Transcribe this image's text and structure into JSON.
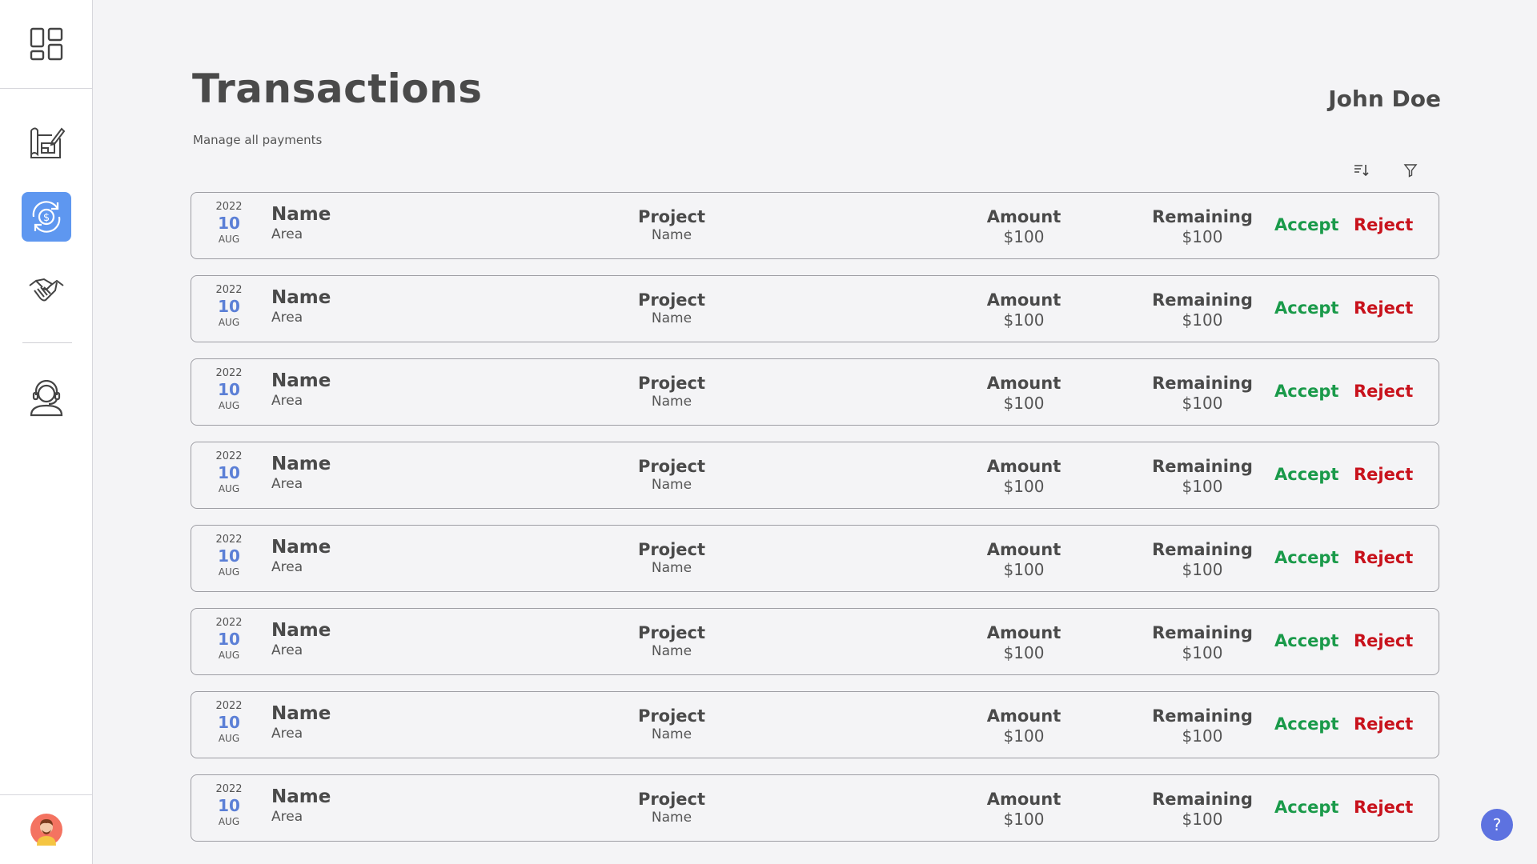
{
  "header": {
    "title": "Transactions",
    "subtitle": "Manage all payments",
    "user_name": "John Doe"
  },
  "sidebar": {
    "items": [
      {
        "icon": "blueprint-icon",
        "active": false
      },
      {
        "icon": "dollar-exchange-icon",
        "active": true
      },
      {
        "icon": "handshake-icon",
        "active": false
      },
      {
        "icon": "support-agent-icon",
        "active": false
      }
    ]
  },
  "toolbar": {
    "sort_icon": "sort-icon",
    "filter_icon": "filter-icon"
  },
  "colors": {
    "accent": "#5e97f0",
    "date_day": "#5b7fd6",
    "accept": "#1a9a4a",
    "reject": "#c8121c",
    "help": "#5d72e0"
  },
  "transactions": [
    {
      "year": "2022",
      "day": "10",
      "month": "AUG",
      "name": "Name",
      "area": "Area",
      "project_label": "Project",
      "project_name": "Name",
      "amount_label": "Amount",
      "amount": "$100",
      "remaining_label": "Remaining",
      "remaining": "$100",
      "accept": "Accept",
      "reject": "Reject"
    },
    {
      "year": "2022",
      "day": "10",
      "month": "AUG",
      "name": "Name",
      "area": "Area",
      "project_label": "Project",
      "project_name": "Name",
      "amount_label": "Amount",
      "amount": "$100",
      "remaining_label": "Remaining",
      "remaining": "$100",
      "accept": "Accept",
      "reject": "Reject"
    },
    {
      "year": "2022",
      "day": "10",
      "month": "AUG",
      "name": "Name",
      "area": "Area",
      "project_label": "Project",
      "project_name": "Name",
      "amount_label": "Amount",
      "amount": "$100",
      "remaining_label": "Remaining",
      "remaining": "$100",
      "accept": "Accept",
      "reject": "Reject"
    },
    {
      "year": "2022",
      "day": "10",
      "month": "AUG",
      "name": "Name",
      "area": "Area",
      "project_label": "Project",
      "project_name": "Name",
      "amount_label": "Amount",
      "amount": "$100",
      "remaining_label": "Remaining",
      "remaining": "$100",
      "accept": "Accept",
      "reject": "Reject"
    },
    {
      "year": "2022",
      "day": "10",
      "month": "AUG",
      "name": "Name",
      "area": "Area",
      "project_label": "Project",
      "project_name": "Name",
      "amount_label": "Amount",
      "amount": "$100",
      "remaining_label": "Remaining",
      "remaining": "$100",
      "accept": "Accept",
      "reject": "Reject"
    },
    {
      "year": "2022",
      "day": "10",
      "month": "AUG",
      "name": "Name",
      "area": "Area",
      "project_label": "Project",
      "project_name": "Name",
      "amount_label": "Amount",
      "amount": "$100",
      "remaining_label": "Remaining",
      "remaining": "$100",
      "accept": "Accept",
      "reject": "Reject"
    },
    {
      "year": "2022",
      "day": "10",
      "month": "AUG",
      "name": "Name",
      "area": "Area",
      "project_label": "Project",
      "project_name": "Name",
      "amount_label": "Amount",
      "amount": "$100",
      "remaining_label": "Remaining",
      "remaining": "$100",
      "accept": "Accept",
      "reject": "Reject"
    },
    {
      "year": "2022",
      "day": "10",
      "month": "AUG",
      "name": "Name",
      "area": "Area",
      "project_label": "Project",
      "project_name": "Name",
      "amount_label": "Amount",
      "amount": "$100",
      "remaining_label": "Remaining",
      "remaining": "$100",
      "accept": "Accept",
      "reject": "Reject"
    }
  ],
  "help": {
    "label": "?"
  }
}
